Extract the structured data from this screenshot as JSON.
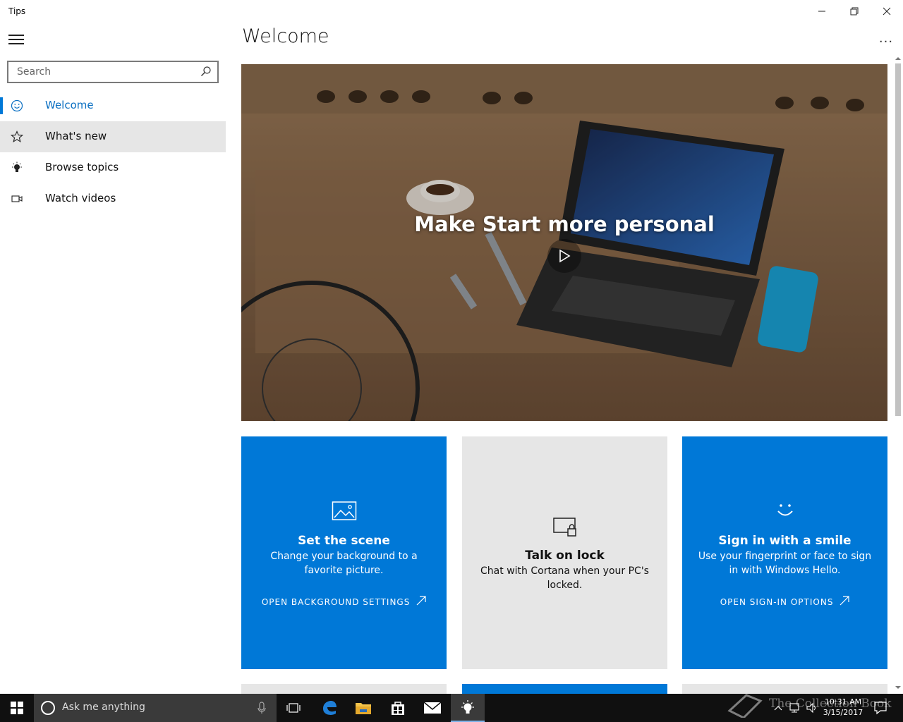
{
  "window": {
    "title": "Tips"
  },
  "sidebar": {
    "search_placeholder": "Search",
    "items": [
      {
        "label": "Welcome",
        "icon": "smiley-icon"
      },
      {
        "label": "What's new",
        "icon": "star-icon"
      },
      {
        "label": "Browse topics",
        "icon": "lightbulb-icon"
      },
      {
        "label": "Watch videos",
        "icon": "video-camera-icon"
      }
    ]
  },
  "main": {
    "title": "Welcome",
    "more": "...",
    "hero": {
      "title": "Make Start more personal"
    },
    "tiles": [
      {
        "title": "Set the scene",
        "desc": "Change your background to a favorite picture.",
        "link": "OPEN BACKGROUND SETTINGS",
        "icon": "picture-icon"
      },
      {
        "title": "Talk on lock",
        "desc": "Chat with Cortana when your PC's locked.",
        "icon": "lock-screen-icon"
      },
      {
        "title": "Sign in with a smile",
        "desc": "Use your fingerprint or face to sign in with Windows Hello.",
        "link": "OPEN SIGN-IN OPTIONS",
        "icon": "smile-icon"
      }
    ]
  },
  "taskbar": {
    "cortana_placeholder": "Ask me anything",
    "time": "10:31 AM",
    "date": "3/15/2017",
    "watermark": "The Collection Book"
  },
  "colors": {
    "accent": "#0078d7",
    "tile_gray": "#e6e6e6"
  }
}
